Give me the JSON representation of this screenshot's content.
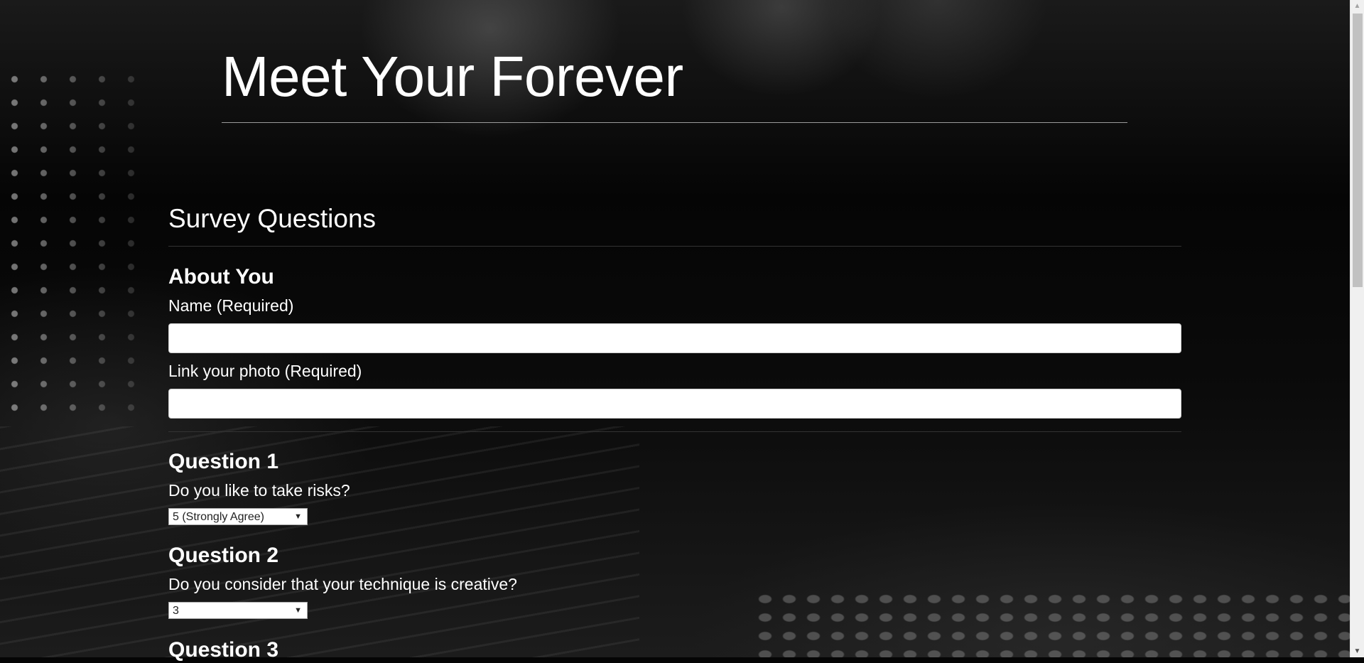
{
  "header": {
    "title": "Meet Your Forever"
  },
  "survey": {
    "title": "Survey Questions",
    "about": {
      "heading": "About You",
      "name_label": "Name (Required)",
      "name_value": "",
      "photo_label": "Link your photo (Required)",
      "photo_value": ""
    },
    "questions": [
      {
        "heading": "Question 1",
        "text": "Do you like to take risks?",
        "selected": "5 (Strongly Agree)"
      },
      {
        "heading": "Question 2",
        "text": "Do you consider that your technique is creative?",
        "selected": "3"
      },
      {
        "heading": "Question 3"
      }
    ]
  },
  "icons": {
    "select_arrow": "▼",
    "scroll_up": "▲",
    "scroll_down": "▼"
  }
}
